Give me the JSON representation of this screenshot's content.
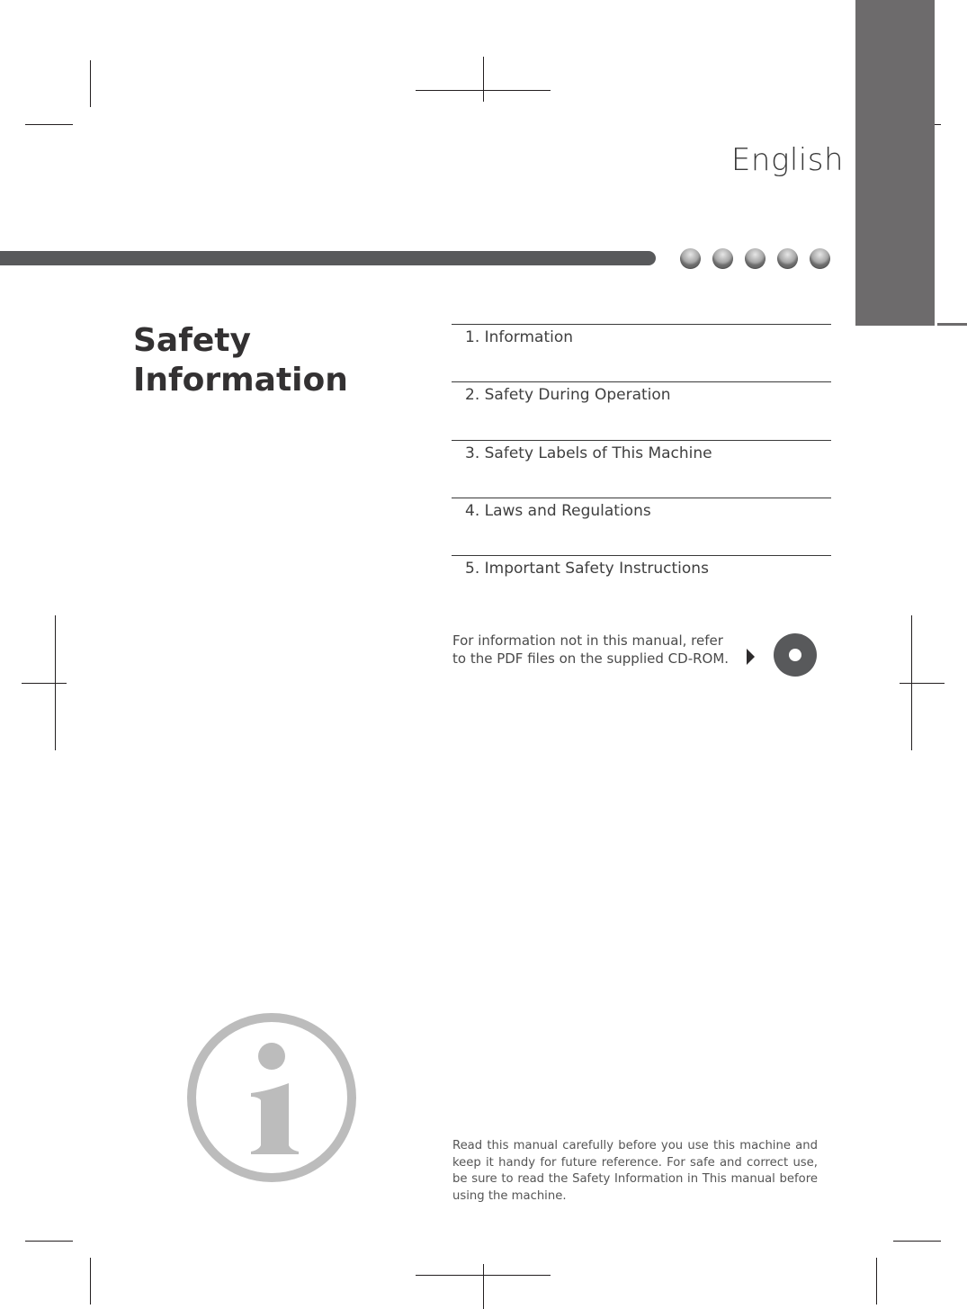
{
  "page": {
    "language_label": "English",
    "title_line1": "Safety",
    "title_line2": "Information",
    "toc": [
      {
        "label": "1. Information"
      },
      {
        "label": "2. Safety During Operation"
      },
      {
        "label": "3. Safety Labels of This Machine"
      },
      {
        "label": "4. Laws and Regulations"
      },
      {
        "label": "5. Important Safety Instructions"
      }
    ],
    "cd_note": "For information not in this manual, refer to the PDF files on the supplied CD-ROM.",
    "footer_note": "Read this manual carefully before you use this machine and keep it handy for future reference. For safe and correct use, be sure to read the Safety Information in This manual before using the machine.",
    "icons": {
      "chapter_dots": "sphere-dot-icon",
      "arrow": "play-arrow-icon",
      "cd": "cd-rom-icon",
      "info": "information-icon"
    },
    "colors": {
      "tab_gray": "#6d6b6c",
      "bar_gray": "#58595b",
      "info_gray": "#bcbcbc"
    }
  }
}
